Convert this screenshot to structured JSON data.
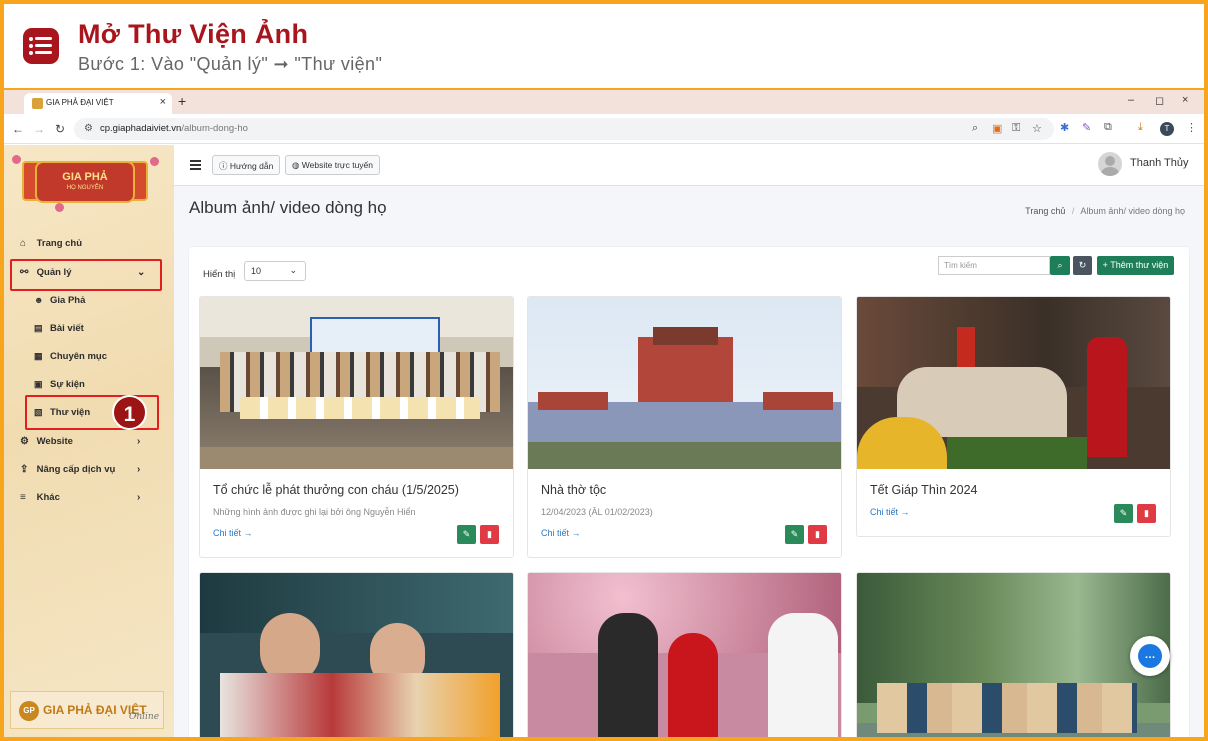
{
  "tutorial": {
    "title": "Mở Thư Viện Ảnh",
    "subtitle": "Bước 1: Vào \"Quản lý\" ➞ \"Thư viện\"",
    "step_number": "1",
    "icon": "list-icon"
  },
  "browser": {
    "tab_title": "GIA PHẢ ĐẠI VIỆT",
    "tab_close": "×",
    "new_tab": "+",
    "url_host": "cp.giaphadaiviet.vn",
    "url_path": "/album-dong-ho",
    "profile_initial": "T",
    "window_controls": [
      "–",
      "◻",
      "×"
    ]
  },
  "topnav": {
    "guide_label": "Hướng dẫn",
    "website_label": "Website trực tuyến",
    "user_name": "Thanh Thủy"
  },
  "sidebar": {
    "logo_text": "GIA PHẢ",
    "logo_sub": "HỌ NGUYỄN",
    "items": [
      {
        "label": "Trang chủ",
        "icon": "home-icon"
      },
      {
        "label": "Quản lý",
        "icon": "sitemap-icon",
        "expanded": true
      },
      {
        "label": "Website",
        "icon": "gear-icon"
      },
      {
        "label": "Nâng cấp dịch vụ",
        "icon": "upgrade-icon"
      },
      {
        "label": "Khác",
        "icon": "bars-icon"
      }
    ],
    "sub_items": [
      {
        "label": "Gia Phả",
        "icon": "users-icon"
      },
      {
        "label": "Bài viết",
        "icon": "newspaper-icon"
      },
      {
        "label": "Chuyên mục",
        "icon": "table-icon"
      },
      {
        "label": "Sự kiện",
        "icon": "calendar-icon"
      },
      {
        "label": "Thư viện",
        "icon": "images-icon",
        "highlighted": true
      }
    ],
    "footer_brand": "GIA PHẢ ĐẠI VIỆT",
    "footer_brand_suffix": "Online",
    "footer_mark": "GP"
  },
  "page": {
    "title": "Album ảnh/ video dòng họ",
    "breadcrumb_home": "Trang chủ",
    "breadcrumb_sep": "/",
    "breadcrumb_current": "Album ảnh/ video dòng họ",
    "show_label": "Hiển thị",
    "show_value": "10",
    "search_placeholder": "Tìm kiếm",
    "add_button": "Thêm thư viện"
  },
  "albums": [
    {
      "title": "Tổ chức lễ phát thưởng con cháu (1/5/2025)",
      "description": "Những hình ảnh được ghi lại bởi ông Nguyễn Hiển",
      "link": "Chi tiết →"
    },
    {
      "title": "Nhà thờ tộc",
      "description": "12/04/2023 (ÂL 01/02/2023)",
      "link": "Chi tiết →"
    },
    {
      "title": "Tết Giáp Thìn 2024",
      "description": "",
      "link": "Chi tiết →"
    }
  ],
  "colors": {
    "accent_red": "#a8151c",
    "highlight": "#e02020",
    "green": "#2a8a5a",
    "danger": "#e03a45",
    "link": "#2b78c5",
    "frame": "#f7a51c"
  }
}
